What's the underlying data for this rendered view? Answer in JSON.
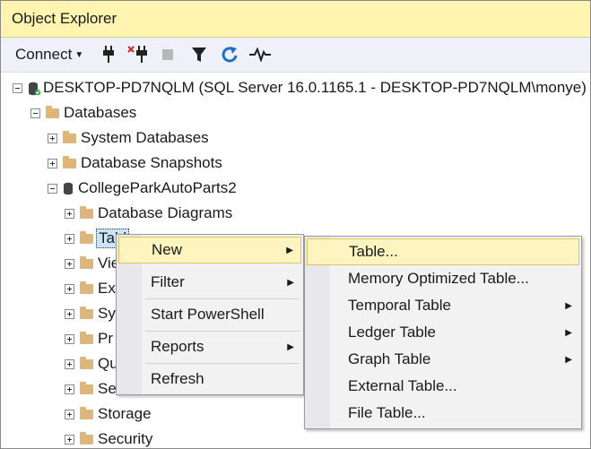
{
  "window": {
    "title": "Object Explorer"
  },
  "toolbar": {
    "connect_label": "Connect",
    "icons": [
      "connect-icon",
      "disconnect-icon",
      "stop-icon",
      "filter-icon",
      "refresh-icon",
      "activity-monitor-icon"
    ]
  },
  "tree": {
    "server": "DESKTOP-PD7NQLM (SQL Server 16.0.1165.1 - DESKTOP-PD7NQLM\\monye)",
    "databases": "Databases",
    "system_databases": "System Databases",
    "database_snapshots": "Database Snapshots",
    "db": "CollegeParkAutoParts2",
    "db_diagrams": "Database Diagrams",
    "tables": "Tabl",
    "views": "Vie",
    "external": "Ext",
    "synonyms": "Sy",
    "programmability": "Pr",
    "query_store": "Qu",
    "service_broker": "Se",
    "storage": "Storage",
    "security": "Security"
  },
  "context_menu": {
    "new": "New",
    "filter": "Filter",
    "start_powershell": "Start PowerShell",
    "reports": "Reports",
    "refresh": "Refresh"
  },
  "submenu": {
    "table": "Table...",
    "memory_optimized": "Memory Optimized Table...",
    "temporal": "Temporal Table",
    "ledger": "Ledger Table",
    "graph": "Graph Table",
    "external": "External Table...",
    "file": "File Table..."
  },
  "colors": {
    "titlebar": "#fff5b0",
    "toolbar": "#eef1f8",
    "highlight": "#fdf4bf",
    "folder": "#dcb67a"
  }
}
